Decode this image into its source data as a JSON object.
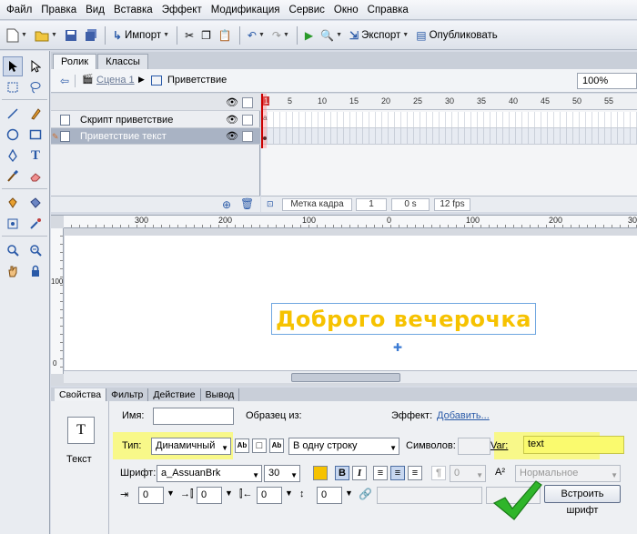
{
  "menu": [
    "Файл",
    "Правка",
    "Вид",
    "Вставка",
    "Эффект",
    "Модификация",
    "Сервис",
    "Окно",
    "Справка"
  ],
  "toolbar": {
    "import_label": "Импорт",
    "export_label": "Экспорт",
    "publish_label": "Опубликовать"
  },
  "doc_tabs": [
    "Ролик",
    "Классы"
  ],
  "editbar": {
    "scene": "Сцена 1",
    "symbol": "Приветствие",
    "zoom": "100%"
  },
  "layers": [
    {
      "name": "Скрипт приветствие"
    },
    {
      "name": "Приветствие текст"
    }
  ],
  "frame_numbers": [
    "1",
    "5",
    "10",
    "15",
    "20",
    "25",
    "30",
    "35",
    "40",
    "45",
    "50",
    "55"
  ],
  "timeline_status": {
    "frame_label": "Метка кадра",
    "frame": "1",
    "time": "0 s",
    "fps": "12 fps"
  },
  "ruler": {
    "h_labels": [
      "300",
      "200",
      "100",
      "0",
      "100",
      "200",
      "300"
    ],
    "v_labels": [
      "100",
      "0"
    ]
  },
  "stage": {
    "text": "Доброго вечерочка"
  },
  "properties": {
    "tabs": [
      "Свойства",
      "Фильтр",
      "Действие",
      "Вывод"
    ],
    "object_type": "Текст",
    "name_label": "Имя:",
    "instance_of_label": "Образец из:",
    "effect_label": "Эффект:",
    "effect_link": "Добавить...",
    "type_label": "Тип:",
    "type_value": "Динамичный",
    "line_type_value": "В одну строку",
    "chars_label": "Символов:",
    "var_label": "Var:",
    "var_value": "text",
    "font_label": "Шрифт:",
    "font_value": "a_AssuanBrk",
    "font_size": "30",
    "bold": "B",
    "italic": "I",
    "kerning_value": "0",
    "aa_value": "Нормальное",
    "indent": "0",
    "left_margin": "0",
    "right_margin": "0",
    "line_spacing": "0",
    "embed_button": "Встроить шрифт",
    "colors": {
      "text_color": "#f6c200",
      "highlight": "#fafa6e",
      "check": "#2fb52a"
    }
  }
}
